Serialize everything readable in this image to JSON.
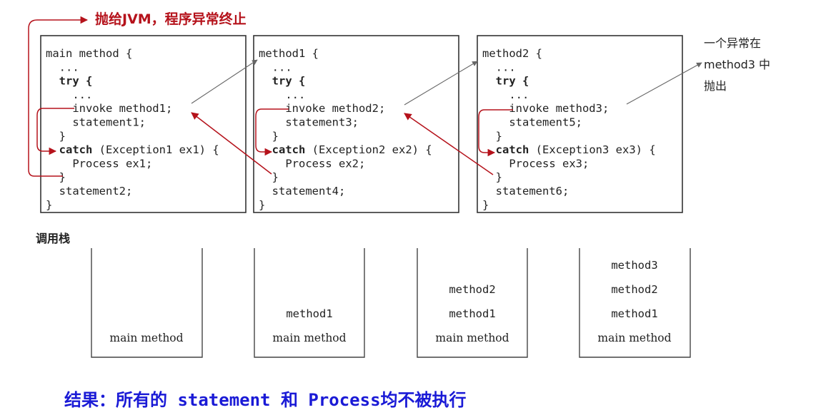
{
  "top_note": "抛给JVM，程序异常终止",
  "side_note": [
    "一个异常在",
    "method3 中",
    "抛出"
  ],
  "call_stack_label": "调用栈",
  "result_text": "结果：所有的 statement 和 Process均不被执行",
  "colors": {
    "red_arrow": "#b5121b",
    "blue_result": "#1a1ad6",
    "gray_arrow": "#666666"
  },
  "methods": [
    {
      "name": "main-method",
      "lines": [
        {
          "code": "main method {",
          "bold": false
        },
        {
          "code": "  ...",
          "bold": false
        },
        {
          "code": "  try {",
          "bold": true
        },
        {
          "code": "    ...",
          "bold": false
        },
        {
          "code": "    invoke method1;",
          "bold": false
        },
        {
          "code": "    statement1;",
          "bold": false
        },
        {
          "code": "  }",
          "bold": false
        },
        {
          "code": "  catch (Exception1 ex1) {",
          "bold": false,
          "kw": "catch"
        },
        {
          "code": "    Process ex1;",
          "bold": false
        },
        {
          "code": "  }",
          "bold": false
        },
        {
          "code": "  statement2;",
          "bold": false
        },
        {
          "code": "}",
          "bold": false
        }
      ]
    },
    {
      "name": "method1",
      "lines": [
        {
          "code": "method1 {",
          "bold": false
        },
        {
          "code": "  ...",
          "bold": false
        },
        {
          "code": "  try {",
          "bold": true
        },
        {
          "code": "    ...",
          "bold": false
        },
        {
          "code": "    invoke method2;",
          "bold": false
        },
        {
          "code": "    statement3;",
          "bold": false
        },
        {
          "code": "  }",
          "bold": false
        },
        {
          "code": "  catch (Exception2 ex2) {",
          "bold": false,
          "kw": "catch"
        },
        {
          "code": "    Process ex2;",
          "bold": false
        },
        {
          "code": "  }",
          "bold": false
        },
        {
          "code": "  statement4;",
          "bold": false
        },
        {
          "code": "}",
          "bold": false
        }
      ]
    },
    {
      "name": "method2",
      "lines": [
        {
          "code": "method2 {",
          "bold": false
        },
        {
          "code": "  ...",
          "bold": false
        },
        {
          "code": "  try {",
          "bold": true
        },
        {
          "code": "    ...",
          "bold": false
        },
        {
          "code": "    invoke method3;",
          "bold": false
        },
        {
          "code": "    statement5;",
          "bold": false
        },
        {
          "code": "  }",
          "bold": false
        },
        {
          "code": "  catch (Exception3 ex3) {",
          "bold": false,
          "kw": "catch"
        },
        {
          "code": "    Process ex3;",
          "bold": false
        },
        {
          "code": "  }",
          "bold": false
        },
        {
          "code": "  statement6;",
          "bold": false
        },
        {
          "code": "}",
          "bold": false
        }
      ]
    }
  ],
  "stacks": [
    [
      "main method"
    ],
    [
      "method1",
      "main method"
    ],
    [
      "method2",
      "method1",
      "main method"
    ],
    [
      "method3",
      "method2",
      "method1",
      "main method"
    ]
  ]
}
